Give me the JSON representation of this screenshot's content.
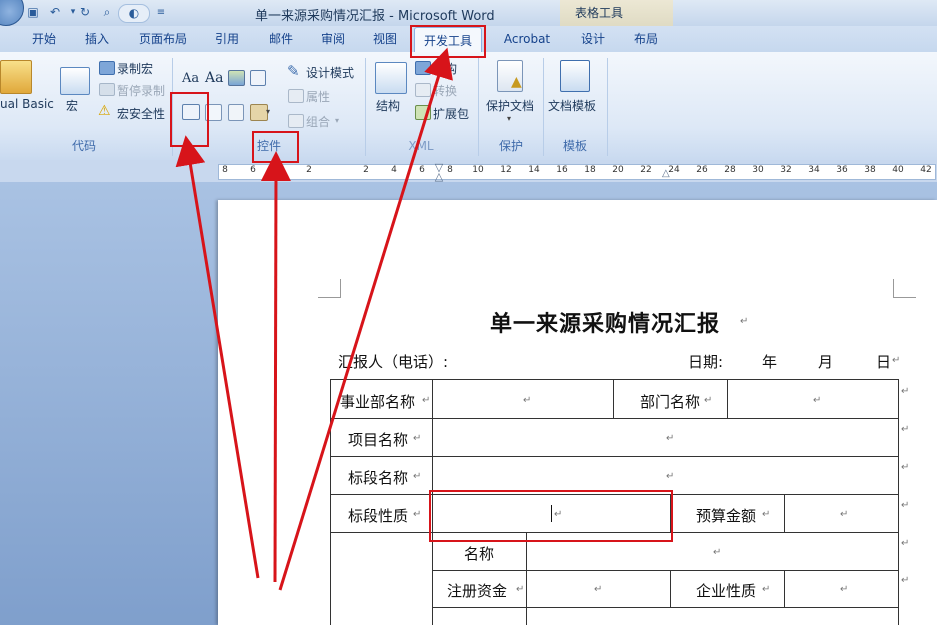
{
  "window": {
    "title": "单一来源采购情况汇报 - Microsoft Word",
    "context_tool_title": "表格工具"
  },
  "quick_access": {
    "items": [
      "save-icon",
      "undo-icon",
      "redo-icon",
      "print-preview-icon",
      "customize-icon"
    ]
  },
  "tabs": [
    "开始",
    "插入",
    "页面布局",
    "引用",
    "邮件",
    "审阅",
    "视图",
    "开发工具",
    "Acrobat",
    "设计",
    "布局"
  ],
  "active_tab": "开发工具",
  "ribbon": {
    "code": {
      "label": "代码",
      "visual_basic": "ual Basic",
      "macros": "宏",
      "record_macro": "录制宏",
      "pause_recording": "暂停录制",
      "macro_security": "宏安全性"
    },
    "controls": {
      "label": "控件",
      "design_mode": "设计模式",
      "properties": "属性",
      "group": "组合"
    },
    "xml": {
      "label": "XML",
      "structure": "结构",
      "schema": "架构",
      "transform": "转换",
      "expansion_pack": "扩展包"
    },
    "protect": {
      "label": "保护",
      "protect_document": "保护文档"
    },
    "templates": {
      "label": "模板",
      "document_template": "文档模板"
    }
  },
  "ruler": {
    "ticks": [
      "8",
      "6",
      "4",
      "2",
      "2",
      "4",
      "6",
      "8",
      "10",
      "12",
      "14",
      "16",
      "18",
      "20",
      "22",
      "24",
      "26",
      "28",
      "30",
      "32",
      "34",
      "36",
      "38",
      "40",
      "42"
    ]
  },
  "document": {
    "title": "单一来源采购情况汇报",
    "reporter_label": "汇报人（电话）:",
    "date_label": "日期:",
    "year": "年",
    "month": "月",
    "day": "日",
    "table": {
      "department_name": "事业部名称",
      "section_name": "部门名称",
      "project_name": "项目名称",
      "lot_name": "标段名称",
      "lot_nature": "标段性质",
      "budget_amount": "预算金额",
      "name": "名称",
      "registered_capital": "注册资金",
      "company_nature": "企业性质"
    }
  },
  "colors": {
    "annotation": "#d7141a",
    "ribbon_text": "#15428b",
    "workspace": "#8fabd4"
  }
}
